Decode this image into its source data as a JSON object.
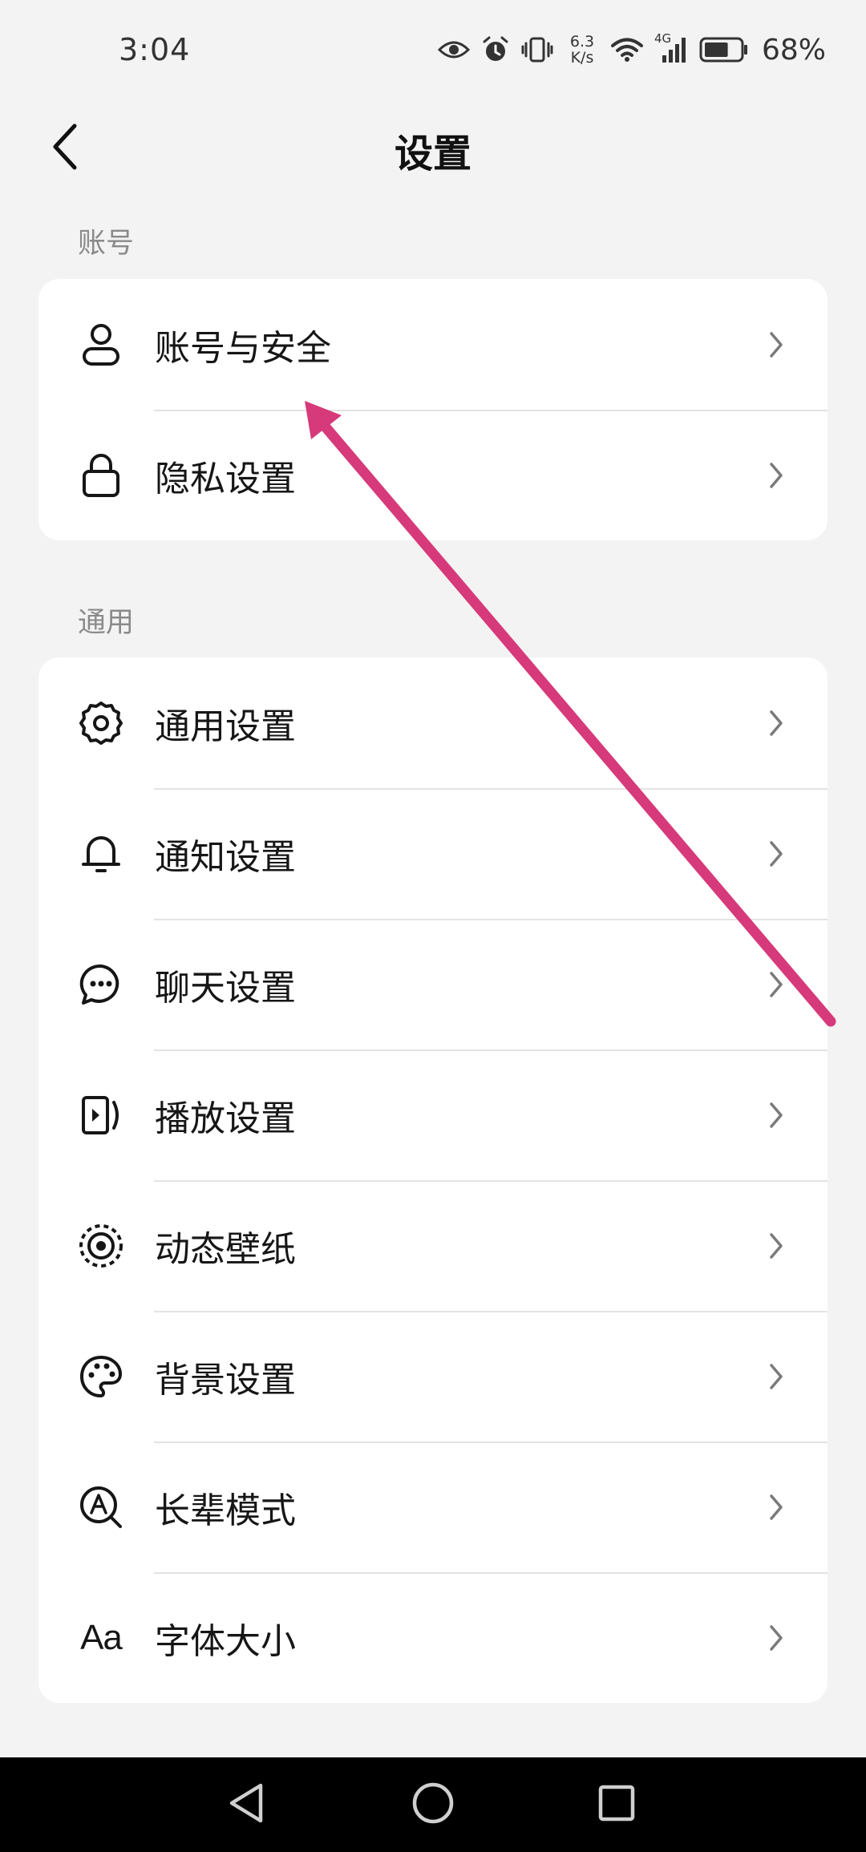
{
  "status_bar": {
    "time": "3:04",
    "net_speed_value": "6.3",
    "net_speed_unit": "K/s",
    "network_type": "4G",
    "battery_percent": "68%",
    "battery_level": 0.68
  },
  "header": {
    "title": "设置",
    "back_icon": "back-chevron-icon"
  },
  "sections": [
    {
      "label": "账号",
      "items": [
        {
          "label": "账号与安全",
          "icon": "user-icon"
        },
        {
          "label": "隐私设置",
          "icon": "lock-icon"
        }
      ]
    },
    {
      "label": "通用",
      "items": [
        {
          "label": "通用设置",
          "icon": "gear-icon"
        },
        {
          "label": "通知设置",
          "icon": "bell-icon"
        },
        {
          "label": "聊天设置",
          "icon": "chat-bubble-icon"
        },
        {
          "label": "播放设置",
          "icon": "play-video-icon"
        },
        {
          "label": "动态壁纸",
          "icon": "live-wallpaper-icon"
        },
        {
          "label": "背景设置",
          "icon": "palette-icon"
        },
        {
          "label": "长辈模式",
          "icon": "elder-mode-icon"
        },
        {
          "label": "字体大小",
          "icon": "font-size-icon",
          "glyph": "Aa"
        }
      ]
    }
  ],
  "annotation": {
    "color": "#d63a7a"
  },
  "nav_bar": {
    "back_icon": "nav-back-triangle-icon",
    "home_icon": "nav-home-circle-icon",
    "recents_icon": "nav-recents-square-icon"
  }
}
